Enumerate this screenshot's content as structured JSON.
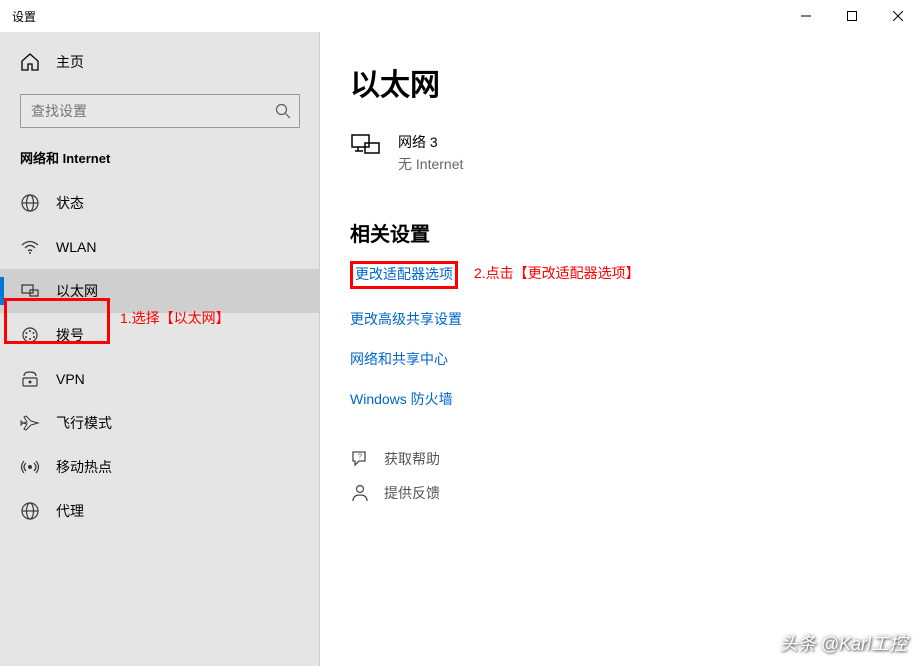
{
  "window": {
    "title": "设置"
  },
  "sidebar": {
    "home": "主页",
    "search_placeholder": "查找设置",
    "category": "网络和 Internet",
    "items": [
      {
        "label": "状态"
      },
      {
        "label": "WLAN"
      },
      {
        "label": "以太网"
      },
      {
        "label": "拨号"
      },
      {
        "label": "VPN"
      },
      {
        "label": "飞行模式"
      },
      {
        "label": "移动热点"
      },
      {
        "label": "代理"
      }
    ]
  },
  "main": {
    "title": "以太网",
    "network": {
      "name": "网络 3",
      "status": "无 Internet"
    },
    "related_title": "相关设置",
    "links": [
      "更改适配器选项",
      "更改高级共享设置",
      "网络和共享中心",
      "Windows 防火墙"
    ],
    "help": "获取帮助",
    "feedback": "提供反馈"
  },
  "annotations": {
    "step1": "1.选择【以太网】",
    "step2": "2.点击【更改适配器选项】"
  },
  "watermark": "头条 @Karl工控"
}
